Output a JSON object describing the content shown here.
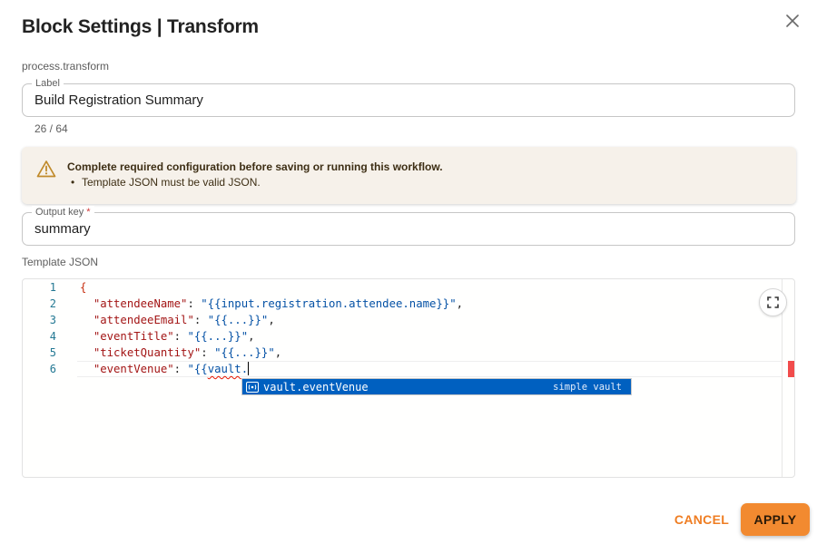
{
  "dialog": {
    "title": "Block Settings | Transform",
    "subtype": "process.transform"
  },
  "label_field": {
    "legend": "Label",
    "value": "Build Registration Summary",
    "counter": "26 / 64"
  },
  "alert": {
    "heading": "Complete required configuration before saving or running this workflow.",
    "items": [
      "Template JSON must be valid JSON."
    ],
    "icon": "warning-triangle-icon",
    "color": "#c08a2a"
  },
  "output_key_field": {
    "legend": "Output key",
    "required_mark": "*",
    "value": "summary"
  },
  "template": {
    "label": "Template JSON",
    "line_numbers": [
      "1",
      "2",
      "3",
      "4",
      "5",
      "6"
    ],
    "lines": [
      [
        {
          "t": "{",
          "c": "brace"
        }
      ],
      [
        {
          "t": "  ",
          "c": "punc"
        },
        {
          "t": "\"attendeeName\"",
          "c": "key"
        },
        {
          "t": ": ",
          "c": "punc"
        },
        {
          "t": "\"{{input.registration.attendee.name}}\"",
          "c": "str"
        },
        {
          "t": ",",
          "c": "punc"
        }
      ],
      [
        {
          "t": "  ",
          "c": "punc"
        },
        {
          "t": "\"attendeeEmail\"",
          "c": "key"
        },
        {
          "t": ": ",
          "c": "punc"
        },
        {
          "t": "\"{{...}}\"",
          "c": "str"
        },
        {
          "t": ",",
          "c": "punc"
        }
      ],
      [
        {
          "t": "  ",
          "c": "punc"
        },
        {
          "t": "\"eventTitle\"",
          "c": "key"
        },
        {
          "t": ": ",
          "c": "punc"
        },
        {
          "t": "\"{{...}}\"",
          "c": "str"
        },
        {
          "t": ",",
          "c": "punc"
        }
      ],
      [
        {
          "t": "  ",
          "c": "punc"
        },
        {
          "t": "\"ticketQuantity\"",
          "c": "key"
        },
        {
          "t": ": ",
          "c": "punc"
        },
        {
          "t": "\"{{...}}\"",
          "c": "str"
        },
        {
          "t": ",",
          "c": "punc"
        }
      ],
      [
        {
          "t": "  ",
          "c": "punc"
        },
        {
          "t": "\"eventVenue\"",
          "c": "key"
        },
        {
          "t": ": ",
          "c": "punc"
        },
        {
          "t": "\"{{",
          "c": "str"
        },
        {
          "t": "vault",
          "c": "str-squiggle"
        },
        {
          "t": ".",
          "c": "str"
        }
      ]
    ],
    "suggestion": {
      "label": "vault.eventVenue",
      "detail": "simple vault",
      "icon": "variable-icon"
    },
    "expand_icon": "expand-icon"
  },
  "actions": {
    "cancel_label": "CANCEL",
    "apply_label": "APPLY",
    "accent_color": "#f28a30"
  }
}
